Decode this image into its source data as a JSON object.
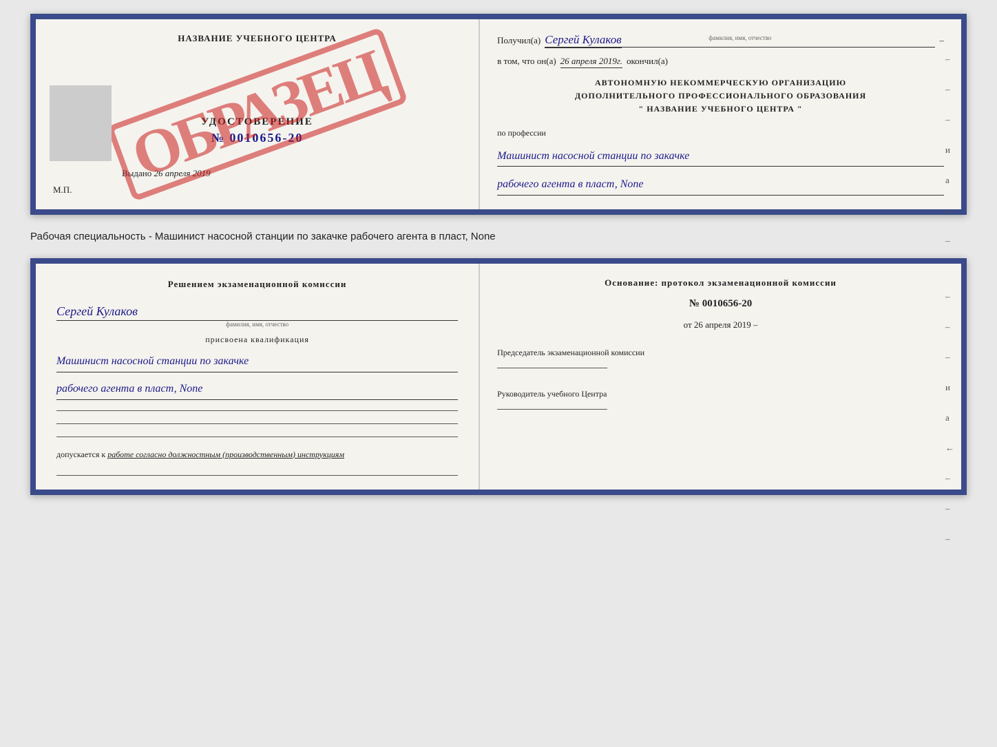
{
  "doc_top": {
    "left": {
      "center_title": "НАЗВАНИЕ УЧЕБНОГО ЦЕНТРА",
      "stamp_text": "ОБРАЗЕЦ",
      "udostoverenie_title": "УДОСТОВЕРЕНИЕ",
      "udostoverenie_number": "№ 0010656-20",
      "vydano_label": "Выдано",
      "vydano_date": "26 апреля 2019",
      "mp_label": "М.П."
    },
    "right": {
      "poluchil_label": "Получил(а)",
      "poluchil_name": "Сергей Кулаков",
      "fio_hint": "фамилия, имя, отчество",
      "dash": "–",
      "vtom_label": "в том, что он(а)",
      "vtom_date": "26 апреля 2019г.",
      "okonchil_label": "окончил(а)",
      "org_line1": "АВТОНОМНУЮ НЕКОММЕРЧЕСКУЮ ОРГАНИЗАЦИЮ",
      "org_line2": "ДОПОЛНИТЕЛЬНОГО ПРОФЕССИОНАЛЬНОГО ОБРАЗОВАНИЯ",
      "org_line3": "\"    НАЗВАНИЕ УЧЕБНОГО ЦЕНТРА    \"",
      "po_professii": "по профессии",
      "profession_line1": "Машинист насосной станции по закачке",
      "profession_line2": "рабочего агента в пласт, None",
      "dashes": [
        " –",
        " –",
        " –",
        " и",
        " а",
        " ←",
        " –"
      ]
    }
  },
  "description": {
    "text": "Рабочая специальность - Машинист насосной станции по закачке рабочего агента в пласт, None"
  },
  "doc_bottom": {
    "left": {
      "resheniem_text": "Решением  экзаменационной  комиссии",
      "fio_name": "Сергей Кулаков",
      "fio_hint": "фамилия, имя, отчество",
      "prisvoena_text": "присвоена квалификация",
      "qualification_line1": "Машинист насосной станции по закачке",
      "qualification_line2": "рабочего агента в пласт, None",
      "dopuskaetsya_label": "допускается к",
      "dopuskaetsya_text": "работе согласно должностным (производственным) инструкциям"
    },
    "right": {
      "osnovanie_text": "Основание:  протокол  экзаменационной  комиссии",
      "protocol_number": "№  0010656-20",
      "ot_label": "от",
      "ot_date": "26 апреля 2019",
      "predsedatel_label": "Председатель экзаменационной комиссии",
      "rukovoditel_label": "Руководитель учебного Центра",
      "dashes": [
        " –",
        " –",
        " –",
        " и",
        " а",
        " ←",
        " –",
        " –",
        " –"
      ]
    }
  }
}
